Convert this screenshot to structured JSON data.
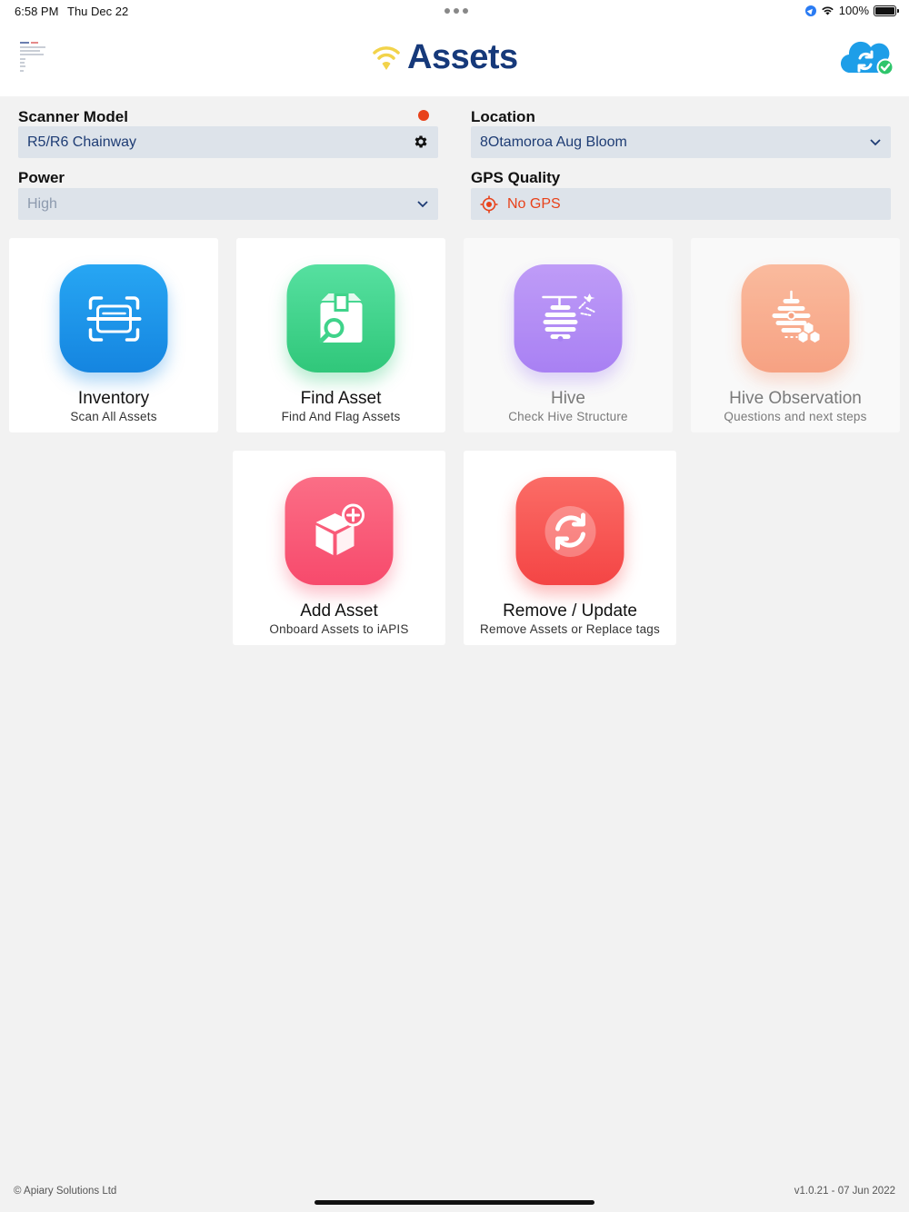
{
  "status_bar": {
    "time": "6:58 PM",
    "date": "Thu Dec 22",
    "battery": "100%"
  },
  "header": {
    "title": "Assets",
    "logo_icon": "wifi-signal-icon",
    "sync_icon": "cloud-sync-check-icon"
  },
  "form": {
    "scanner_model": {
      "label": "Scanner Model",
      "value": "R5/R6 Chainway",
      "status_color": "#e8421a"
    },
    "location": {
      "label": "Location",
      "value": "8Otamoroa Aug Bloom"
    },
    "power": {
      "label": "Power",
      "value": "High"
    },
    "gps_quality": {
      "label": "GPS Quality",
      "value": "No GPS",
      "color": "#e8421a"
    }
  },
  "cards": [
    {
      "title": "Inventory",
      "subtitle": "Scan All Assets",
      "icon": "scan-icon",
      "color": "#1f96ef"
    },
    {
      "title": "Find Asset",
      "subtitle": "Find And Flag Assets",
      "icon": "search-box-icon",
      "color": "#3fd38a"
    },
    {
      "title": "Hive",
      "subtitle": "Check Hive Structure",
      "icon": "beehive-icon",
      "color": "#a97ef5"
    },
    {
      "title": "Hive Observation",
      "subtitle": "Questions and next steps",
      "icon": "hive-observation-icon",
      "color": "#f8a07c"
    },
    {
      "title": "Add Asset",
      "subtitle": "Onboard Assets to iAPIS",
      "icon": "add-box-icon",
      "color": "#f95a78"
    },
    {
      "title": "Remove / Update",
      "subtitle": "Remove Assets or Replace tags",
      "icon": "refresh-icon",
      "color": "#f65452"
    }
  ],
  "footer": {
    "copyright": "© Apiary Solutions Ltd",
    "version": "v1.0.21 - 07 Jun 2022"
  }
}
